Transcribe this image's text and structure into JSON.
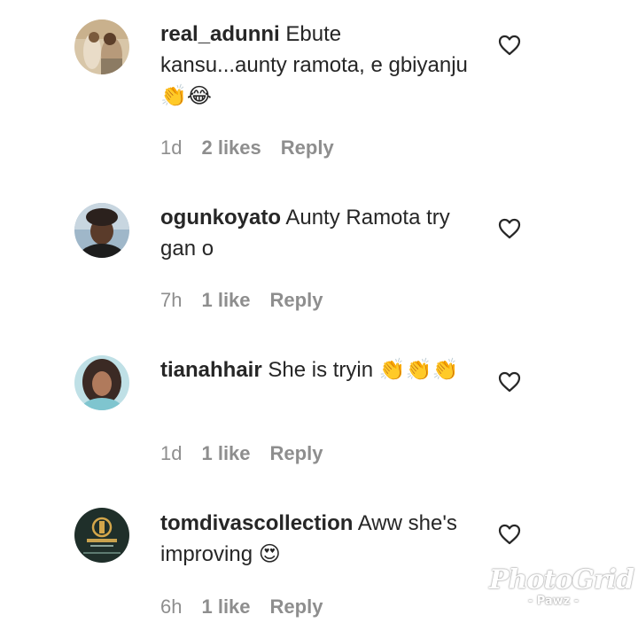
{
  "comments": [
    {
      "username": "real_adunni",
      "text_before": "Ebute kansu...aunty ramota, e gbiyanju",
      "emoji": "👏😂",
      "time": "1d",
      "likes": "2 likes",
      "reply": "Reply",
      "avatar_icon": "avatar-photo"
    },
    {
      "username": "ogunkoyato",
      "text_before": "Aunty Ramota try gan o",
      "emoji": "",
      "time": "7h",
      "likes": "1 like",
      "reply": "Reply",
      "avatar_icon": "avatar-photo"
    },
    {
      "username": "tianahhair",
      "text_before": "She is tryin",
      "emoji": "👏👏👏",
      "time": "1d",
      "likes": "1 like",
      "reply": "Reply",
      "avatar_icon": "avatar-photo"
    },
    {
      "username": "tomdivascollection",
      "text_before": "Aww she's improving",
      "emoji": "😍",
      "time": "6h",
      "likes": "1 like",
      "reply": "Reply",
      "avatar_icon": "avatar-logo"
    }
  ],
  "watermark": {
    "main": "PhotoGrid",
    "sub": "- Pawz -"
  },
  "icons": {
    "like": "heart-outline-icon"
  }
}
